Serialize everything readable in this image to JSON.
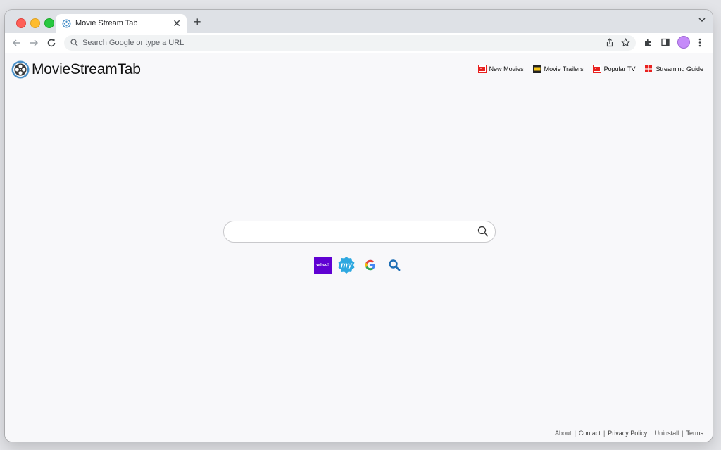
{
  "browser": {
    "tab_title": "Movie Stream Tab",
    "omnibox_placeholder": "Search Google or type a URL"
  },
  "page": {
    "logo_text": "MovieStreamTab",
    "top_links": [
      {
        "label": "New Movies",
        "icon": "new-movies-icon",
        "color": "#e8201e"
      },
      {
        "label": "Movie Trailers",
        "icon": "imdb-icon",
        "color": "#f5c518"
      },
      {
        "label": "Popular TV",
        "icon": "popular-tv-icon",
        "color": "#e8201e"
      },
      {
        "label": "Streaming Guide",
        "icon": "streaming-guide-icon",
        "color": "#e8201e"
      }
    ],
    "search": {
      "value": "",
      "placeholder": ""
    },
    "engines": [
      {
        "name": "yahoo",
        "label": "yahoo!",
        "color": "#6001d2"
      },
      {
        "name": "myway",
        "label": "my",
        "color": "#2ea8e0"
      },
      {
        "name": "google",
        "label": "G",
        "color": "#4285f4"
      },
      {
        "name": "ask",
        "label": "",
        "color": "#1f6fb5"
      }
    ],
    "footer_links": [
      "About",
      "Contact",
      "Privacy Policy",
      "Uninstall",
      "Terms"
    ]
  }
}
